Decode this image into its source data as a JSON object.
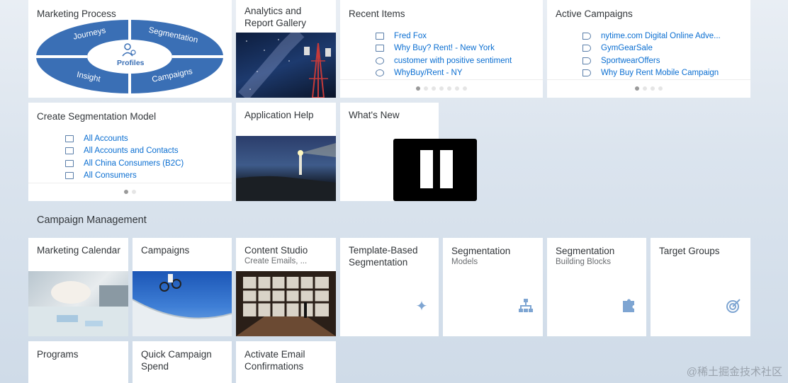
{
  "tiles": {
    "marketing_process": {
      "title": "Marketing Process",
      "segments": {
        "top_left": "Journeys",
        "top_right": "Segmentation",
        "bottom_left": "Insight",
        "bottom_right": "Campaigns",
        "center": "Profiles"
      },
      "colors": {
        "wheel": "#3a6fb5",
        "accent": "#ffffff"
      }
    },
    "analytics_gallery": {
      "title_line1": "Analytics and",
      "title_line2": "Report Gallery"
    },
    "recent_items": {
      "title": "Recent Items",
      "items": [
        {
          "icon": "contact-card-icon",
          "label": "Fred Fox"
        },
        {
          "icon": "puzzle-icon",
          "label": "Why Buy? Rent! - New York"
        },
        {
          "icon": "target-icon",
          "label": "customer with positive sentiment"
        },
        {
          "icon": "target-icon",
          "label": "WhyBuy/Rent - NY"
        }
      ],
      "pages": 7,
      "active_page": 1
    },
    "active_campaigns": {
      "title": "Active Campaigns",
      "items": [
        {
          "icon": "megaphone-icon",
          "label": "nytime.com Digital Online Adve..."
        },
        {
          "icon": "megaphone-icon",
          "label": "GymGearSale"
        },
        {
          "icon": "megaphone-icon",
          "label": "SportwearOffers"
        },
        {
          "icon": "megaphone-icon",
          "label": "Why Buy Rent Mobile Campaign"
        }
      ],
      "pages": 4,
      "active_page": 1
    },
    "create_segmentation": {
      "title": "Create Segmentation Model",
      "items": [
        {
          "icon": "contact-card-icon",
          "label": "All Accounts"
        },
        {
          "icon": "contact-card-icon",
          "label": "All Accounts and Contacts"
        },
        {
          "icon": "contact-card-icon",
          "label": "All China Consumers (B2C)"
        },
        {
          "icon": "contact-card-icon",
          "label": "All Consumers"
        }
      ],
      "pages": 2,
      "active_page": 1
    },
    "application_help": {
      "title": "Application Help"
    },
    "whats_new": {
      "title": "What's New"
    }
  },
  "section": {
    "title": "Campaign Management"
  },
  "campaign_tiles": {
    "marketing_calendar": {
      "title": "Marketing Calendar"
    },
    "campaigns": {
      "title": "Campaigns"
    },
    "content_studio": {
      "title": "Content Studio",
      "subtitle": "Create Emails, ..."
    },
    "template_segmentation": {
      "title_line1": "Template-Based",
      "title_line2": "Segmentation",
      "icon": "magic-wand-icon"
    },
    "segmentation_models": {
      "title": "Segmentation",
      "subtitle": "Models",
      "icon": "hierarchy-icon"
    },
    "segmentation_blocks": {
      "title": "Segmentation",
      "subtitle": "Building Blocks",
      "icon": "puzzle-icon"
    },
    "target_groups": {
      "title": "Target Groups",
      "icon": "target-icon"
    },
    "programs": {
      "title": "Programs"
    },
    "quick_campaign": {
      "title_line1": "Quick Campaign",
      "title_line2": "Spend"
    },
    "activate_email": {
      "title_line1": "Activate Email",
      "title_line2": "Confirmations"
    }
  },
  "overlay": {
    "icon": "pause-icon"
  },
  "watermark": {
    "text": "@稀土掘金技术社区"
  }
}
